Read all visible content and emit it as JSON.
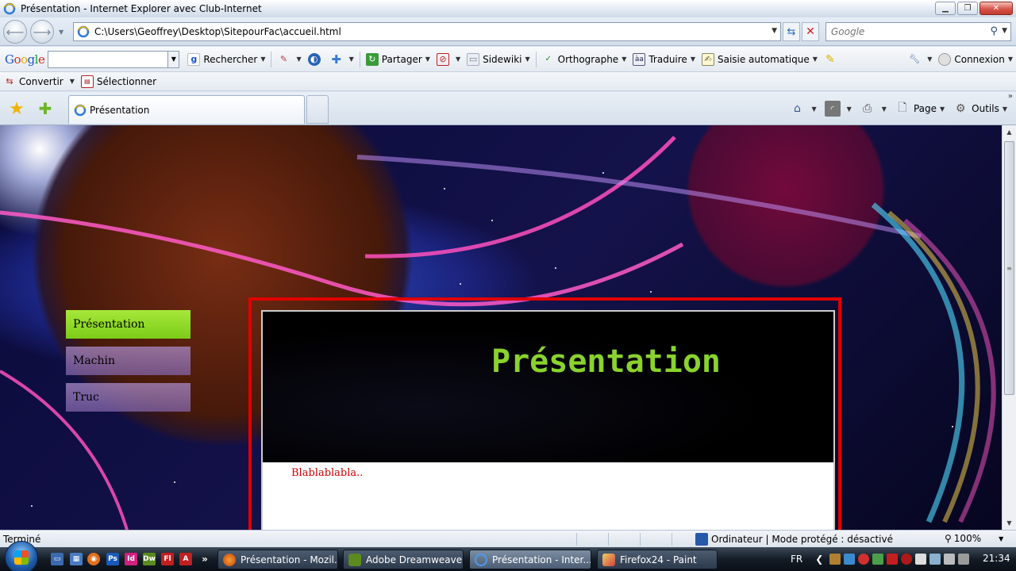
{
  "window": {
    "title": "Présentation - Internet Explorer avec Club-Internet"
  },
  "address_bar": {
    "url": "C:\\Users\\Geoffrey\\Desktop\\SitepourFac\\accueil.html",
    "search_placeholder": "Google"
  },
  "google_toolbar": {
    "logo": "Google",
    "rechercher": "Rechercher",
    "partager": "Partager",
    "sidewiki": "Sidewiki",
    "orthographe": "Orthographe",
    "traduire": "Traduire",
    "saisie": "Saisie automatique",
    "connexion": "Connexion"
  },
  "convert_bar": {
    "convertir": "Convertir",
    "selectionner": "Sélectionner"
  },
  "tabs": {
    "active_label": "Présentation"
  },
  "command_bar": {
    "page": "Page",
    "outils": "Outils"
  },
  "page": {
    "menu": [
      "Présentation",
      "Machin",
      "Truc"
    ],
    "active_menu_index": 0,
    "banner_title": "Présentation",
    "body_text": "Blablablabla.."
  },
  "status_bar": {
    "status": "Terminé",
    "zone": "Ordinateur | Mode protégé : désactivé",
    "zoom": "100%"
  },
  "taskbar": {
    "tasks": [
      {
        "label": "Présentation - Mozil...",
        "icon": "firefox-icon",
        "active": false
      },
      {
        "label": "Adobe Dreamweave...",
        "icon": "dreamweaver-icon",
        "active": false
      },
      {
        "label": "Présentation - Inter...",
        "icon": "internet-explorer-icon",
        "active": true
      },
      {
        "label": "Firefox24 - Paint",
        "icon": "paint-icon",
        "active": false
      }
    ],
    "language": "FR",
    "clock": "21:34"
  },
  "colors": {
    "menu_active": "#8ad22e",
    "menu_inactive": "#9a7cc0",
    "frame_border": "#e00000",
    "banner_title": "#8ad22e",
    "body_text": "#cc0000"
  }
}
